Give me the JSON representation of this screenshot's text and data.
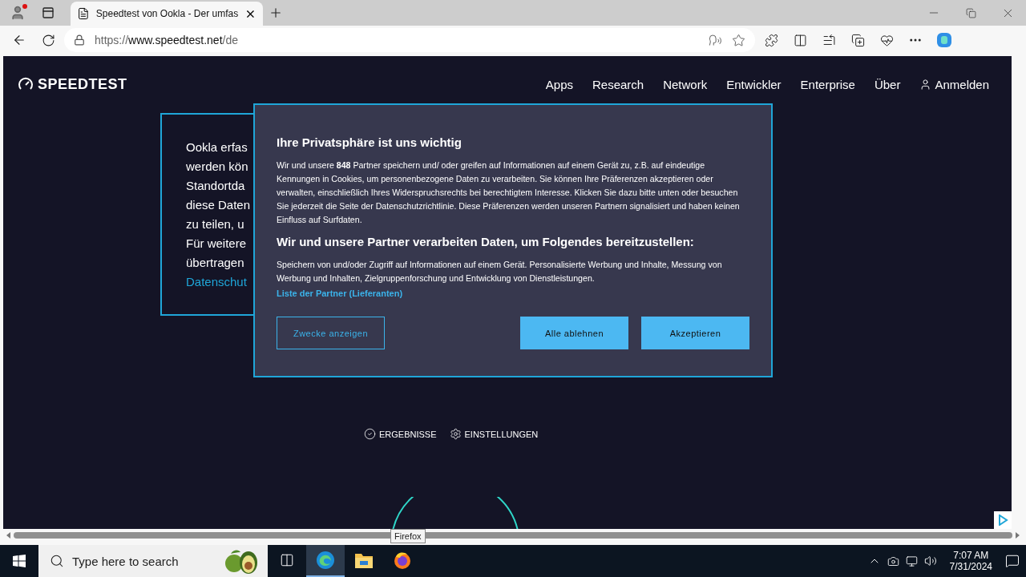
{
  "browser": {
    "tab_title": "Speedtest von Ookla - Der umfas",
    "url_scheme": "https://",
    "url_host": "www.speedtest.net",
    "url_path": "/de"
  },
  "site": {
    "logo": "SPEEDTEST",
    "nav": [
      "Apps",
      "Research",
      "Network",
      "Entwickler",
      "Enterprise",
      "Über"
    ],
    "login": "Anmelden"
  },
  "background_card": {
    "lines": [
      "Ookla erfas",
      "werden kön",
      "Standortda",
      "diese Daten",
      "zu teilen, u",
      "Für weitere",
      "übertragen"
    ],
    "link": "Datenschut"
  },
  "consent": {
    "title": "Ihre Privatsphäre ist uns wichtig",
    "body": "Wir und unsere **848** Partner speichern und/ oder greifen auf Informationen auf einem Gerät zu, z.B. auf eindeutige Kennungen in Cookies, um personenbezogene Daten zu verarbeiten. Sie können Ihre Präferenzen akzeptieren oder verwalten, einschließlich Ihres Widerspruchsrechts bei berechtigtem Interesse. Klicken Sie dazu bitte unten oder besuchen Sie jederzeit die Seite der Datenschutzrichtlinie. Diese Präferenzen werden unseren Partnern signalisiert und haben keinen Einfluss auf Surfdaten.",
    "subtitle": "Wir und unsere Partner verarbeiten Daten, um Folgendes bereitzustellen:",
    "purposes": "Speichern von und/oder Zugriff auf Informationen auf einem Gerät. Personalisierte Werbung und Inhalte, Messung von Werbung und Inhalten, Zielgruppenforschung und Entwicklung von Dienstleistungen.",
    "partners_link": "Liste der Partner (Lieferanten)",
    "buttons": [
      {
        "label": "Zwecke anzeigen",
        "kind": "outline"
      },
      {
        "label": "Alle ablehnen",
        "kind": "filled"
      },
      {
        "label": "Akzeptieren",
        "kind": "filled"
      }
    ]
  },
  "links": [
    {
      "label": "ERGEBNISSE",
      "kind": "results"
    },
    {
      "label": "EINSTELLUNGEN",
      "kind": "settings"
    }
  ],
  "tooltip": "Firefox",
  "taskbar": {
    "search_placeholder": "Type here to search",
    "apps": [
      {
        "kind": "edge",
        "selected": true
      },
      {
        "kind": "explorer",
        "selected": false
      },
      {
        "kind": "firefox",
        "selected": false
      }
    ],
    "time": "7:07 AM",
    "date": "7/31/2024"
  }
}
